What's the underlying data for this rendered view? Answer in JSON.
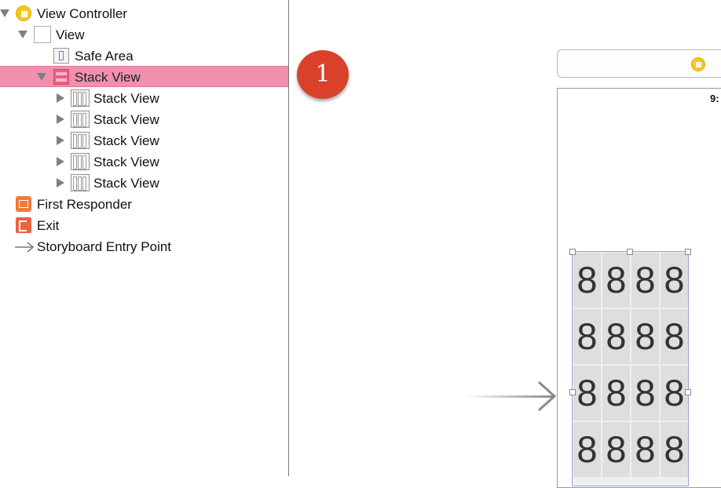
{
  "outline": {
    "items": [
      {
        "label": "View Controller",
        "icon": "view-controller-icon",
        "indent": 0,
        "disclosure": "expanded",
        "selected": false
      },
      {
        "label": "View",
        "icon": "view-icon",
        "indent": 1,
        "disclosure": "expanded",
        "selected": false
      },
      {
        "label": "Safe Area",
        "icon": "safe-area-icon",
        "indent": 2,
        "disclosure": "none",
        "selected": false
      },
      {
        "label": "Stack View",
        "icon": "horizontal-stack-icon",
        "indent": 2,
        "disclosure": "expanded",
        "selected": true
      },
      {
        "label": "Stack View",
        "icon": "vertical-stack-icon",
        "indent": 3,
        "disclosure": "collapsed",
        "selected": false
      },
      {
        "label": "Stack View",
        "icon": "vertical-stack-icon",
        "indent": 3,
        "disclosure": "collapsed",
        "selected": false
      },
      {
        "label": "Stack View",
        "icon": "vertical-stack-icon",
        "indent": 3,
        "disclosure": "collapsed",
        "selected": false
      },
      {
        "label": "Stack View",
        "icon": "vertical-stack-icon",
        "indent": 3,
        "disclosure": "collapsed",
        "selected": false
      },
      {
        "label": "Stack View",
        "icon": "vertical-stack-icon",
        "indent": 3,
        "disclosure": "collapsed",
        "selected": false
      },
      {
        "label": "First Responder",
        "icon": "first-responder-icon",
        "indent": 0,
        "disclosure": "none",
        "selected": false
      },
      {
        "label": "Exit",
        "icon": "exit-icon",
        "indent": 0,
        "disclosure": "none",
        "selected": false
      },
      {
        "label": "Storyboard Entry Point",
        "icon": "entry-point-arrow-icon",
        "indent": 0,
        "disclosure": "none",
        "selected": false
      }
    ]
  },
  "colors": {
    "selection": "#ef91ad",
    "badge": "#d9412b",
    "view_controller": "#f7c623",
    "stack_view": "#e96080"
  },
  "canvas": {
    "step_badge": "1",
    "status_time": "9:",
    "grid": [
      [
        "8",
        "8",
        "8",
        "8"
      ],
      [
        "8",
        "8",
        "8",
        "8"
      ],
      [
        "8",
        "8",
        "8",
        "8"
      ],
      [
        "8",
        "8",
        "8",
        "8"
      ]
    ]
  }
}
